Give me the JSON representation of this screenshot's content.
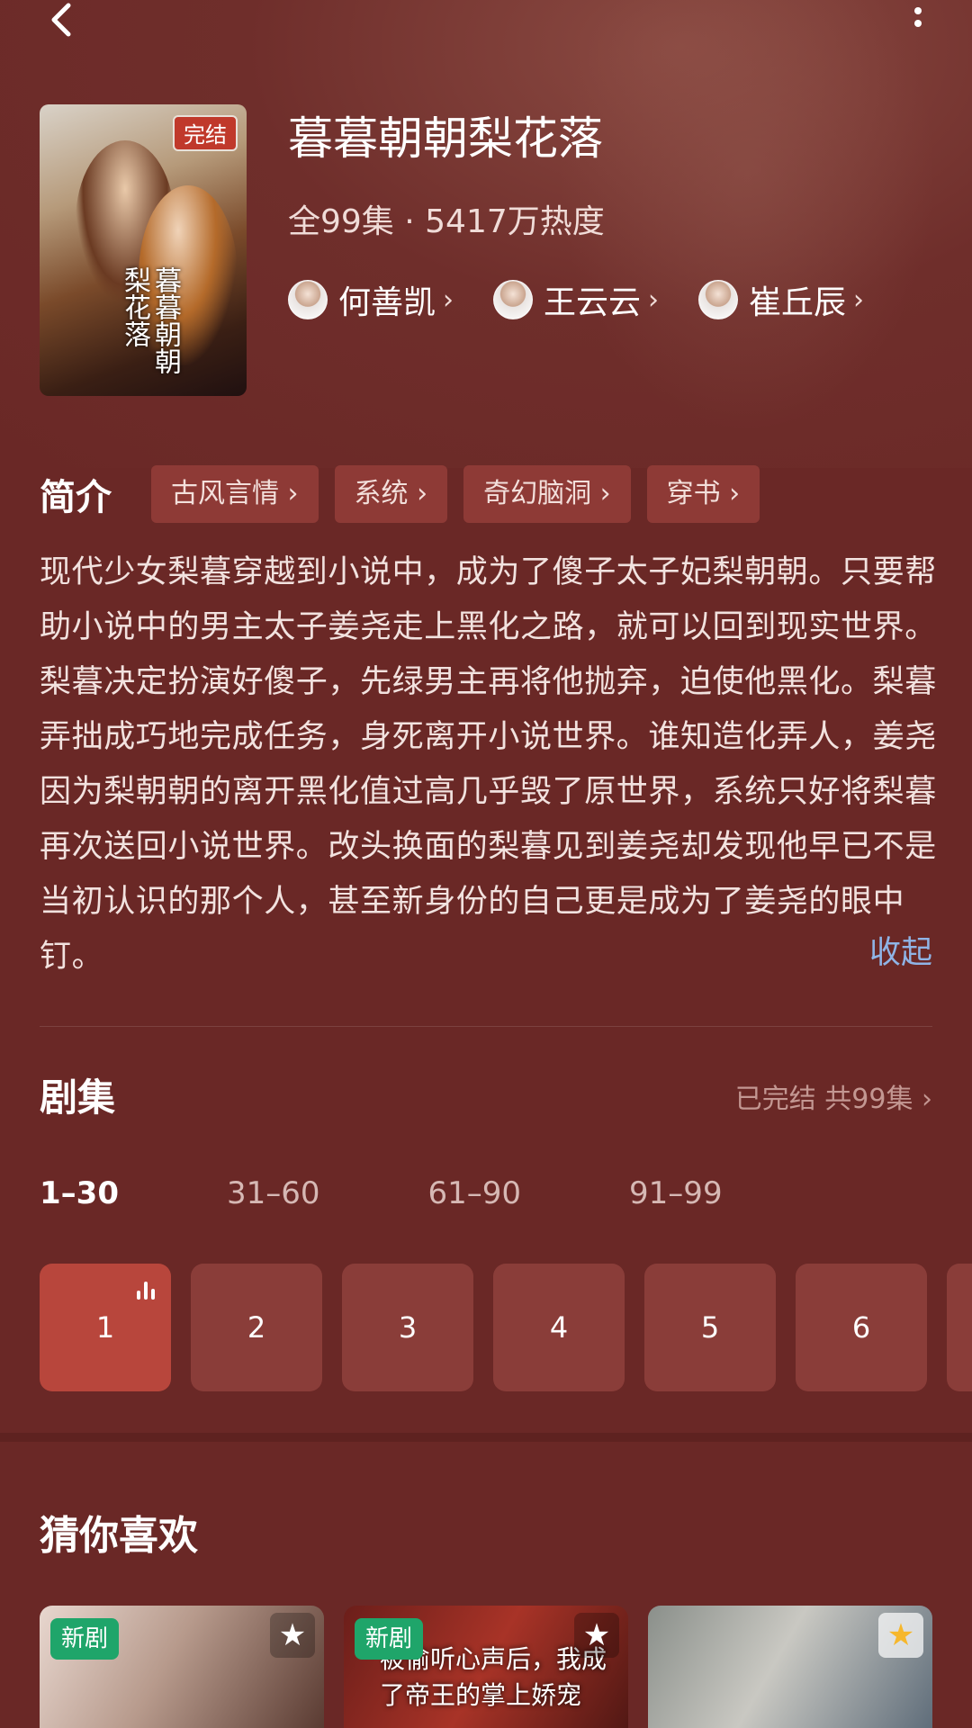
{
  "drama": {
    "title": "暮暮朝朝梨花落",
    "status_badge": "完结",
    "meta": "全99集 · 5417万热度",
    "poster_title": "暮暮朝朝梨花落"
  },
  "cast": [
    {
      "name": "何善凯"
    },
    {
      "name": "王云云"
    },
    {
      "name": "崔丘辰"
    }
  ],
  "chevron": "›",
  "intro": {
    "label": "简介",
    "tags": [
      "古风言情 ›",
      "系统 ›",
      "奇幻脑洞 ›",
      "穿书 ›"
    ],
    "synopsis": "现代少女梨暮穿越到小说中，成为了傻子太子妃梨朝朝。只要帮助小说中的男主太子姜尧走上黑化之路，就可以回到现实世界。梨暮决定扮演好傻子，先绿男主再将他抛弃，迫使他黑化。梨暮弄拙成巧地完成任务，身死离开小说世界。谁知造化弄人，姜尧因为梨朝朝的离开黑化值过高几乎毁了原世界，系统只好将梨暮再次送回小说世界。改头换面的梨暮见到姜尧却发现他早已不是当初认识的那个人，甚至新身份的自己更是成为了姜尧的眼中钉。",
    "collapse_label": "收起"
  },
  "episodes": {
    "header": "剧集",
    "status": "已完结 共99集 ›",
    "ranges": [
      "1–30",
      "31–60",
      "61–90",
      "91–99"
    ],
    "active_range": 0,
    "items": [
      "1",
      "2",
      "3",
      "4",
      "5",
      "6",
      ""
    ],
    "playing_index": 0
  },
  "recommend": {
    "header": "猜你喜欢",
    "cards": [
      {
        "badge": "新剧",
        "star": "★",
        "star_color": "#ffffff",
        "text": ""
      },
      {
        "badge": "新剧",
        "star": "★",
        "star_color": "#ffffff",
        "text": "被偷听心声后，我成了帝王的掌上娇宠"
      },
      {
        "badge": "",
        "star": "★",
        "star_color": "#f6b72c",
        "text": ""
      }
    ]
  },
  "colors": {
    "background": "#6a2826",
    "tag_bg": "#8e3a36",
    "episode_active": "#b8463c",
    "link": "#8fb4e6",
    "new_badge": "#1fa56a"
  },
  "icons": {
    "back": "chevron-left-icon",
    "more": "more-vertical-icon",
    "playing": "playing-bars-icon",
    "favorite": "star-icon"
  }
}
